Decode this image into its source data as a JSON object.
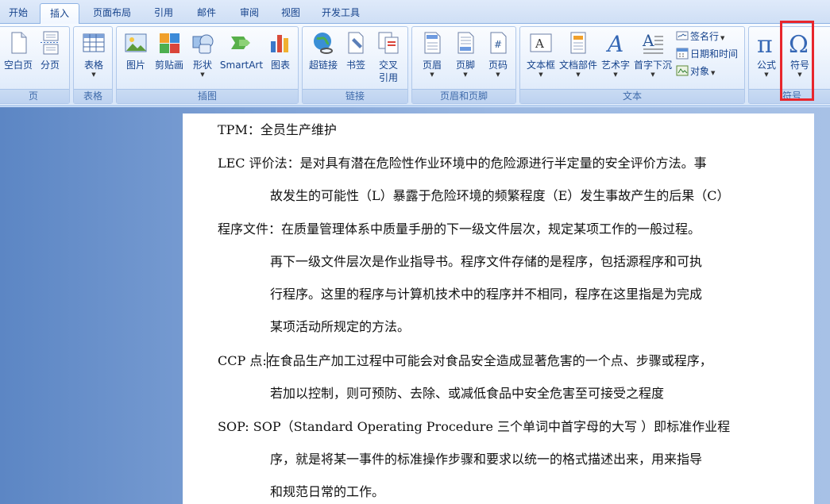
{
  "tabs": [
    "开始",
    "插入",
    "页面布局",
    "引用",
    "邮件",
    "审阅",
    "视图",
    "开发工具"
  ],
  "active_tab": "插入",
  "groups": {
    "page": {
      "label": "页",
      "buttons": [
        "空白页",
        "分页"
      ]
    },
    "table": {
      "label": "表格",
      "buttons": [
        "表格"
      ]
    },
    "illustrations": {
      "label": "插图",
      "buttons": [
        "图片",
        "剪贴画",
        "形状",
        "SmartArt",
        "图表"
      ]
    },
    "links": {
      "label": "链接",
      "buttons": [
        "超链接",
        "书签",
        "交叉引用"
      ]
    },
    "header_footer": {
      "label": "页眉和页脚",
      "buttons": [
        "页眉",
        "页脚",
        "页码"
      ]
    },
    "text": {
      "label": "文本",
      "buttons": [
        "文本框",
        "文档部件",
        "艺术字",
        "首字下沉"
      ],
      "small_buttons": [
        "签名行",
        "日期和时间",
        "对象"
      ]
    },
    "symbols": {
      "label": "符号",
      "buttons": [
        "公式",
        "符号"
      ]
    }
  },
  "document": {
    "p1": {
      "line1": "TPM：全员生产维护"
    },
    "p2": {
      "line1": "LEC 评价法：是对具有潜在危险性作业环境中的危险源进行半定量的安全评价方法。事",
      "line2": "故发生的可能性（L）暴露于危险环境的频繁程度（E）发生事故产生的后果（C）"
    },
    "p3": {
      "line1": "程序文件：在质量管理体系中质量手册的下一级文件层次，规定某项工作的一般过程。",
      "line2": "再下一级文件层次是作业指导书。程序文件存储的是程序，包括源程序和可执",
      "line3": "行程序。这里的程序与计算机技术中的程序并不相同，程序在这里指是为完成",
      "line4": "某项活动所规定的方法。"
    },
    "p4": {
      "line1a": "CCP 点:",
      "line1b": "在食品生产加工过程中可能会对食品安全造成显著危害的一个点、步骤或程序，",
      "line2": "若加以控制，则可预防、去除、或减低食品中安全危害至可接受之程度"
    },
    "p5": {
      "line1": "SOP: SOP（Standard Operating Procedure 三个单词中首字母的大写 ）即标准作业程",
      "line2": "序，就是将某一事件的标准操作步骤和要求以统一的格式描述出来，用来指导",
      "line3": "和规范日常的工作。"
    }
  },
  "colors": {
    "highlight": "#e8262c",
    "ribbon_text": "#15428b"
  }
}
